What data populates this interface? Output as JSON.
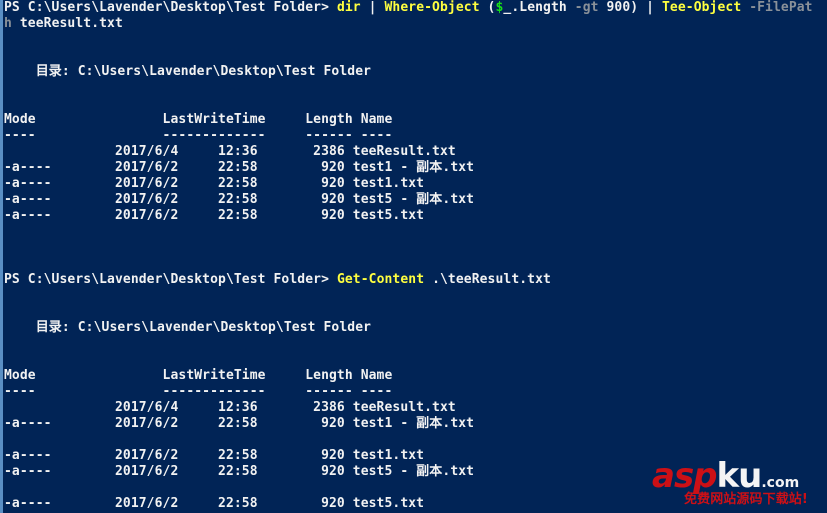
{
  "window": {
    "title": "Windows PowerShell",
    "background_color": "#012456",
    "foreground_color": "#f2f2f2",
    "cmdlet_color": "#ffff3f",
    "parameter_color": "#8a9199",
    "variable_color": "#18e018"
  },
  "prompt": {
    "prefix": "PS ",
    "path": "C:\\Users\\Lavender\\Desktop\\Test Folder",
    "suffix": "> "
  },
  "command1": {
    "dir": "dir",
    "pipe": " | ",
    "where_object": "Where-Object",
    "open_paren": " (",
    "dollar": "$",
    "underscore_length": "_.Length",
    "gt": " -gt ",
    "nine_hundred": "900)",
    "tee_object": "Tee-Object",
    "filepath_param_wrapped_part1": " -FilePat",
    "filepath_param_wrapped_part2": "h",
    "filepath_value": " teeResult.txt"
  },
  "command2": {
    "get_content": "Get-Content",
    "argument": " .\\teeResult.txt"
  },
  "listing1": {
    "directory_label": "    目录: C:\\Users\\Lavender\\Desktop\\Test Folder",
    "headers": {
      "mode": "Mode",
      "lastwritetime": "LastWriteTime",
      "length": "Length",
      "name": "Name"
    },
    "header_line": "Mode                LastWriteTime     Length Name",
    "separator_line": "----                -------------     ------ ----",
    "rows": [
      {
        "mode": "",
        "date": "2017/6/4",
        "time": "12:36",
        "length": "2386",
        "name": "teeResult.txt",
        "text": "              2017/6/4     12:36       2386 teeResult.txt"
      },
      {
        "mode": "-a----",
        "date": "2017/6/2",
        "time": "22:58",
        "length": "920",
        "name": "test1 - 副本.txt",
        "text": "-a----        2017/6/2     22:58        920 test1 - 副本.txt"
      },
      {
        "mode": "-a----",
        "date": "2017/6/2",
        "time": "22:58",
        "length": "920",
        "name": "test1.txt",
        "text": "-a----        2017/6/2     22:58        920 test1.txt"
      },
      {
        "mode": "-a----",
        "date": "2017/6/2",
        "time": "22:58",
        "length": "920",
        "name": "test5 - 副本.txt",
        "text": "-a----        2017/6/2     22:58        920 test5 - 副本.txt"
      },
      {
        "mode": "-a----",
        "date": "2017/6/2",
        "time": "22:58",
        "length": "920",
        "name": "test5.txt",
        "text": "-a----        2017/6/2     22:58        920 test5.txt"
      }
    ]
  },
  "listing2": {
    "directory_label": "    目录: C:\\Users\\Lavender\\Desktop\\Test Folder",
    "headers": {
      "mode": "Mode",
      "lastwritetime": "LastWriteTime",
      "length": "Length",
      "name": "Name"
    },
    "header_line": "Mode                LastWriteTime     Length Name",
    "separator_line": "----                -------------     ------ ----",
    "rows": [
      {
        "mode": "",
        "date": "2017/6/4",
        "time": "12:36",
        "length": "2386",
        "name": "teeResult.txt",
        "text": "              2017/6/4     12:36       2386 teeResult.txt"
      },
      {
        "mode": "-a----",
        "date": "2017/6/2",
        "time": "22:58",
        "length": "920",
        "name": "test1 - 副本.txt",
        "text": "-a----        2017/6/2     22:58        920 test1 - 副本.txt"
      },
      {
        "mode": "-a----",
        "date": "2017/6/2",
        "time": "22:58",
        "length": "920",
        "name": "test1.txt",
        "text": "-a----        2017/6/2     22:58        920 test1.txt"
      },
      {
        "mode": "-a----",
        "date": "2017/6/2",
        "time": "22:58",
        "length": "920",
        "name": "test5 - 副本.txt",
        "text": "-a----        2017/6/2     22:58        920 test5 - 副本.txt"
      },
      {
        "mode": "-a----",
        "date": "2017/6/2",
        "time": "22:58",
        "length": "920",
        "name": "test5.txt",
        "text": "-a----        2017/6/2     22:58        920 test5.txt"
      }
    ]
  },
  "watermark": {
    "asp": "asp",
    "ku": "ku",
    "com": ".com",
    "tagline": "免费网站源码下载站!",
    "red": "#cc1016",
    "white": "#f4f4f4"
  }
}
